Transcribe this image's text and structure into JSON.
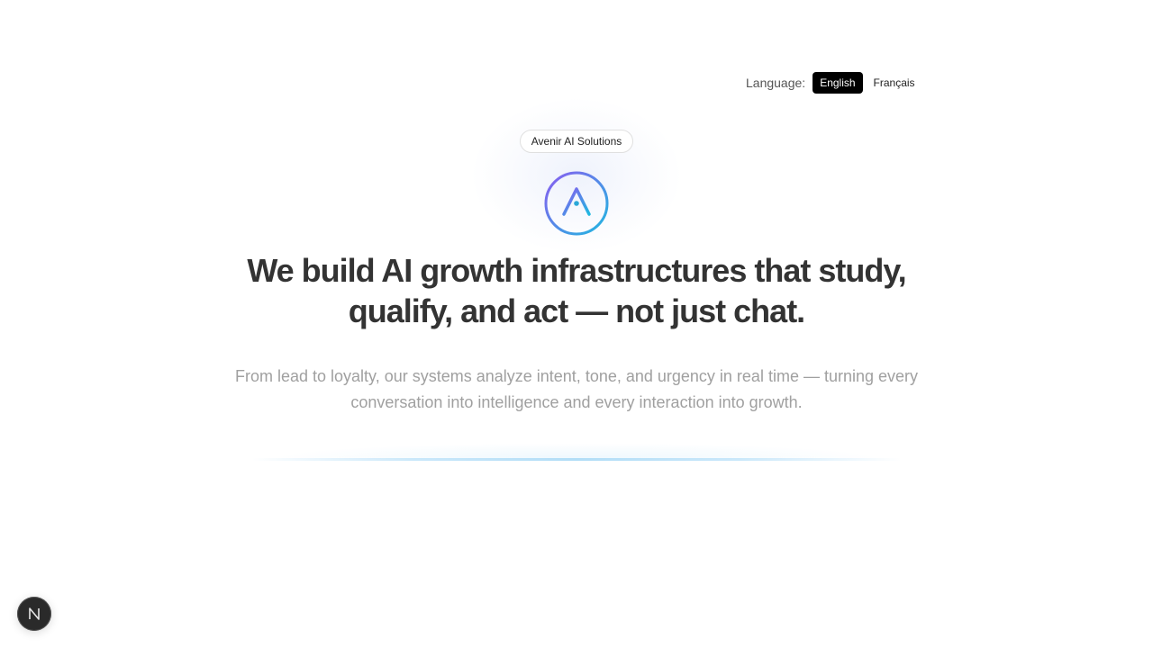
{
  "language": {
    "label": "Language:",
    "options": [
      "English",
      "Français"
    ],
    "selected": "English"
  },
  "hero": {
    "badge": "Avenir AI Solutions",
    "logo_icon": "avenir-a-logo-icon",
    "headline_line1": "We build AI growth infrastructures that study,",
    "headline_line2": "qualify, and act — not just chat.",
    "subtext_line1": "From lead to loyalty, our systems analyze intent, tone, and urgency in real time — turning every",
    "subtext_line2": "conversation into intelligence and every interaction into growth."
  },
  "devtools": {
    "icon": "nextjs-n-icon"
  },
  "colors": {
    "logo_gradient_start": "#7b5cf0",
    "logo_gradient_end": "#22b5e0",
    "headline": "#333333",
    "subtext": "#a0a0a0",
    "active_lang_bg": "#000000"
  }
}
